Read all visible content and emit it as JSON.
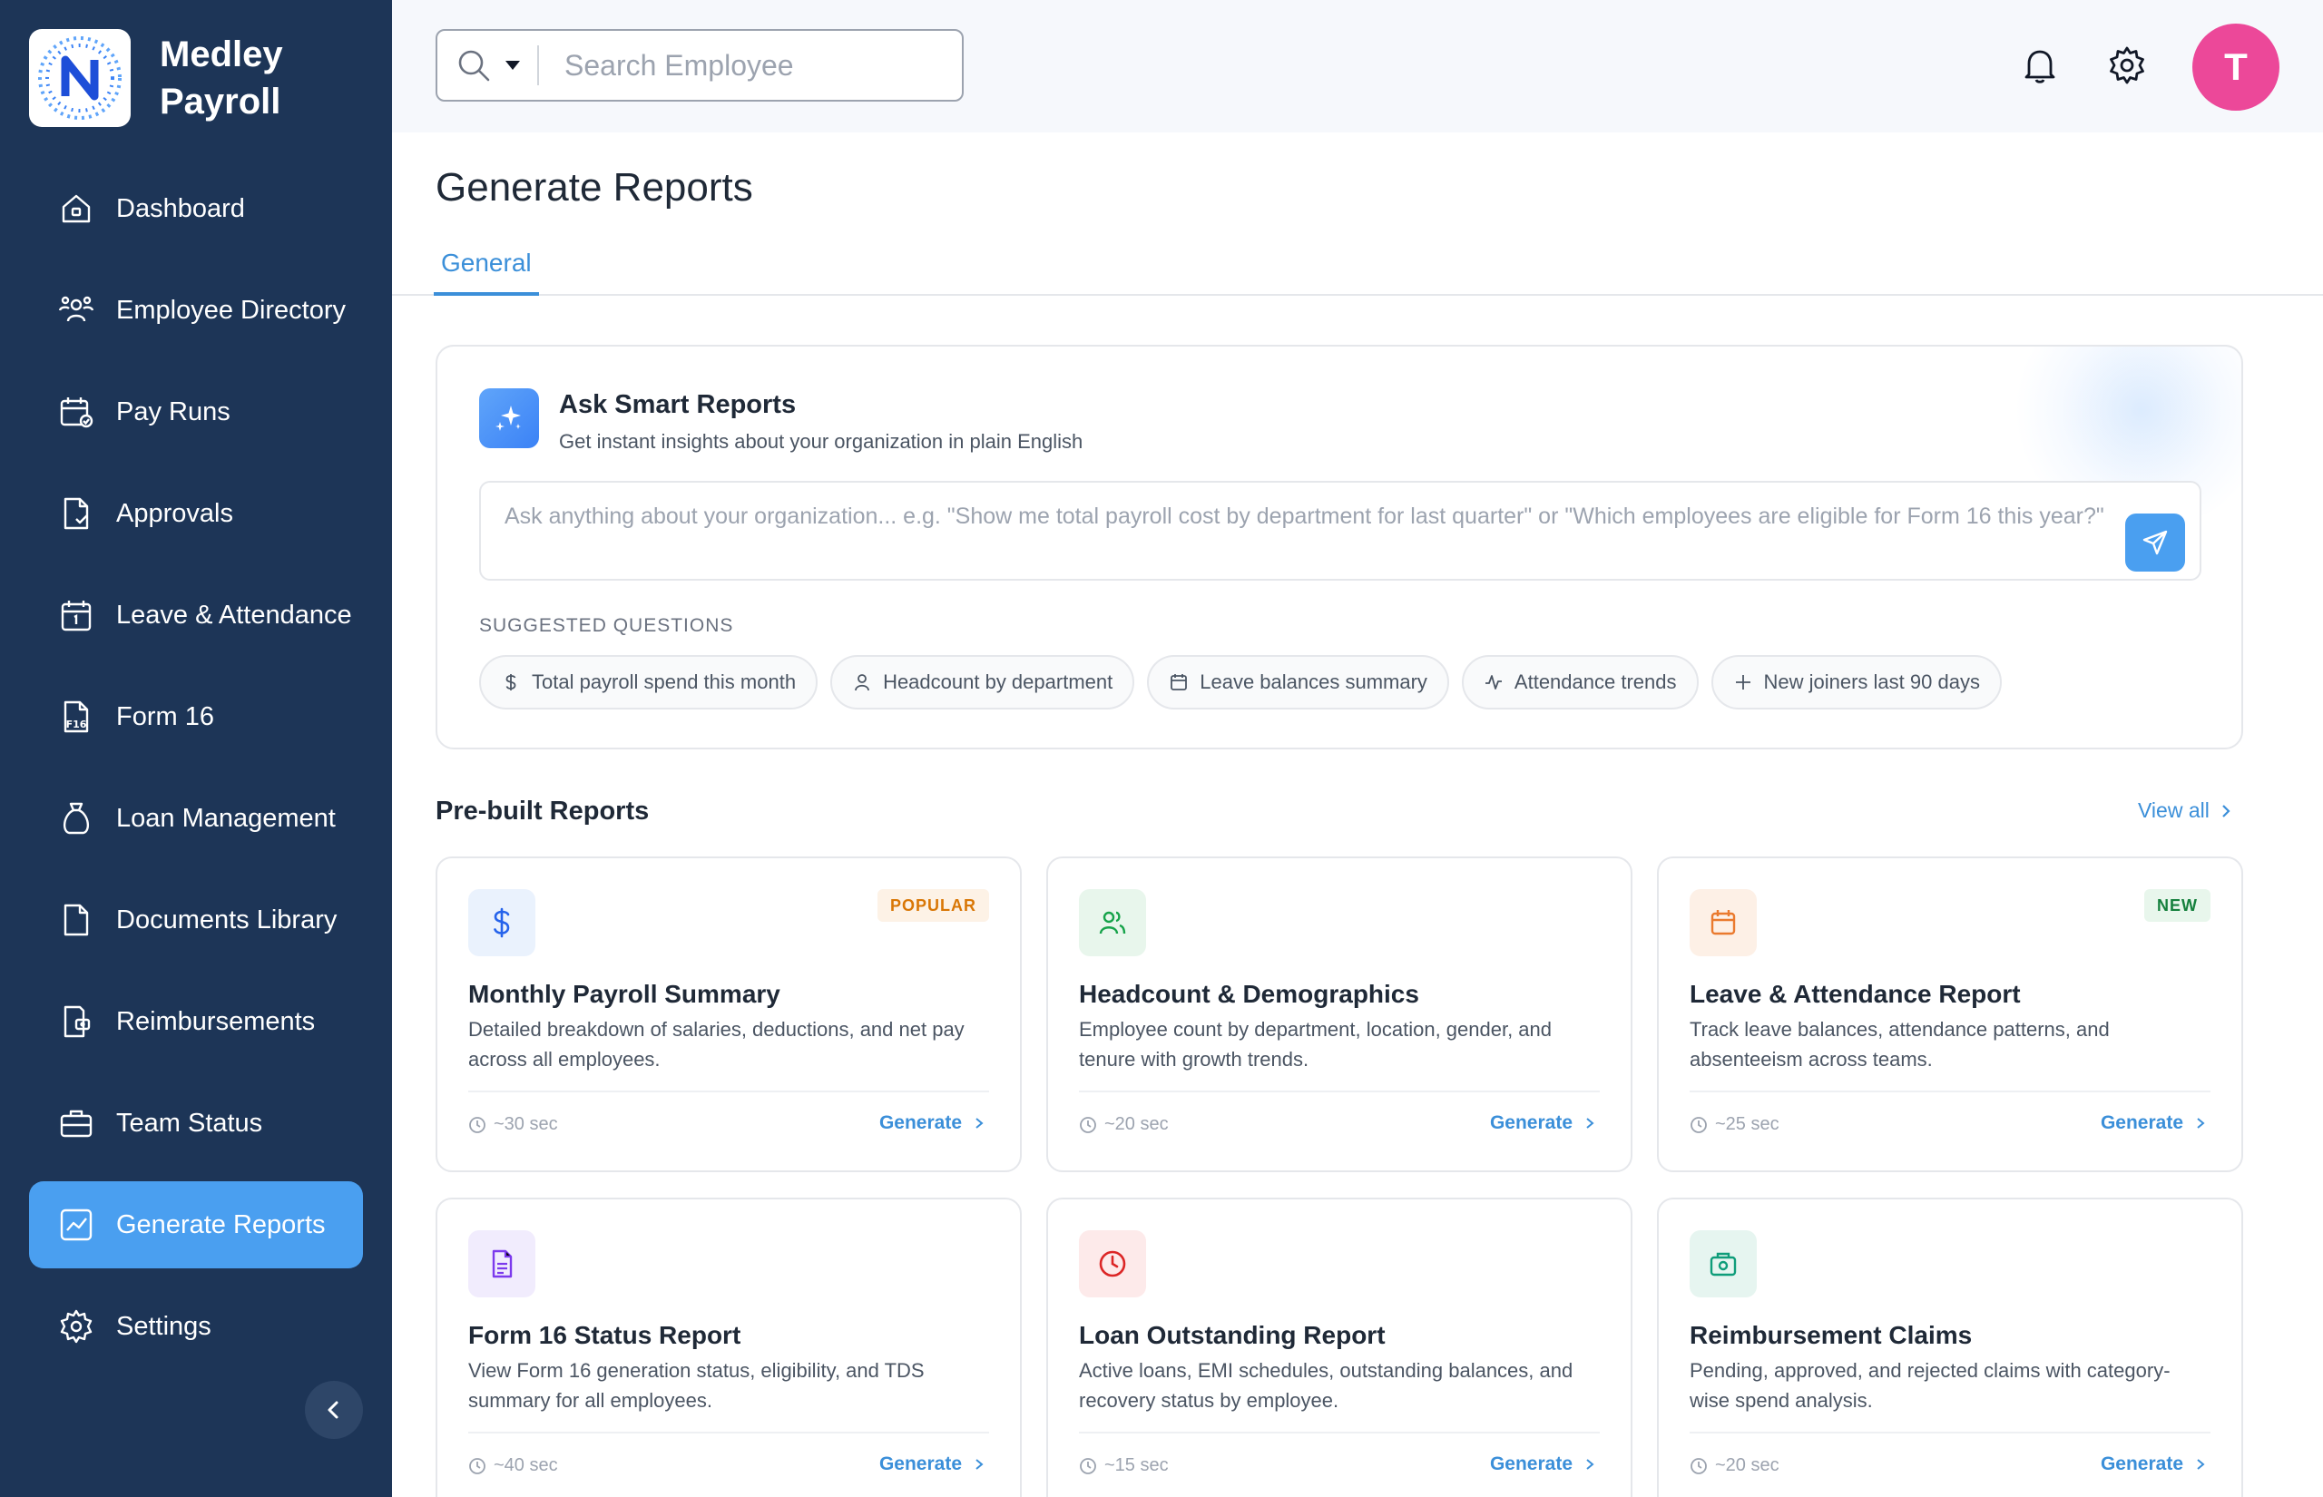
{
  "brand": {
    "name_line1": "Medley",
    "name_line2": "Payroll",
    "logo_letter": "N"
  },
  "sidebar": {
    "items": [
      {
        "label": "Dashboard",
        "icon": "home-icon"
      },
      {
        "label": "Employee Directory",
        "icon": "users-icon"
      },
      {
        "label": "Pay Runs",
        "icon": "calendar-check-icon"
      },
      {
        "label": "Approvals",
        "icon": "document-check-icon"
      },
      {
        "label": "Leave & Attendance",
        "icon": "calendar-icon"
      },
      {
        "label": "Form 16",
        "icon": "form16-icon",
        "icon_text": "F16"
      },
      {
        "label": "Loan Management",
        "icon": "money-bag-icon"
      },
      {
        "label": "Documents Library",
        "icon": "file-icon"
      },
      {
        "label": "Reimbursements",
        "icon": "wallet-icon"
      },
      {
        "label": "Team Status",
        "icon": "briefcase-icon"
      },
      {
        "label": "Generate Reports",
        "icon": "chart-icon",
        "active": true
      },
      {
        "label": "Settings",
        "icon": "gear-icon"
      }
    ]
  },
  "topbar": {
    "search_placeholder": "Search Employee",
    "avatar_initial": "T",
    "avatar_color": "#ec4899"
  },
  "page": {
    "title": "Generate Reports",
    "tab": "General"
  },
  "smart": {
    "title": "Ask Smart Reports",
    "subtitle": "Get instant insights about your organization in plain English",
    "placeholder": "Ask anything about your organization... e.g. \"Show me total payroll cost by department for last quarter\" or \"Which employees are eligible for Form 16 this year?\"",
    "suggested_label": "SUGGESTED QUESTIONS",
    "chips": [
      {
        "label": "Total payroll spend this month",
        "icon": "dollar-icon"
      },
      {
        "label": "Headcount by department",
        "icon": "user-icon"
      },
      {
        "label": "Leave balances summary",
        "icon": "calendar-icon"
      },
      {
        "label": "Attendance trends",
        "icon": "activity-icon"
      },
      {
        "label": "New joiners last 90 days",
        "icon": "plus-icon"
      }
    ]
  },
  "prebuilt": {
    "title": "Pre-built Reports",
    "view_all": "View all",
    "generate_label": "Generate",
    "cards": [
      {
        "title": "Monthly Payroll Summary",
        "desc": "Detailed breakdown of salaries, deductions, and net pay across all employees.",
        "time": "~30 sec",
        "badge": "POPULAR",
        "icon": "dollar-icon",
        "accent": "#2563eb"
      },
      {
        "title": "Headcount & Demographics",
        "desc": "Employee count by department, location, gender, and tenure with growth trends.",
        "time": "~20 sec",
        "badge": "",
        "icon": "users-icon",
        "accent": "#16a34a"
      },
      {
        "title": "Leave & Attendance Report",
        "desc": "Track leave balances, attendance patterns, and absenteeism across teams.",
        "time": "~25 sec",
        "badge": "NEW",
        "icon": "calendar-icon",
        "accent": "#ea7a2e"
      },
      {
        "title": "Form 16 Status Report",
        "desc": "View Form 16 generation status, eligibility, and TDS summary for all employees.",
        "time": "~40 sec",
        "badge": "",
        "icon": "document-icon",
        "accent": "#7c3aed"
      },
      {
        "title": "Loan Outstanding Report",
        "desc": "Active loans, EMI schedules, outstanding balances, and recovery status by employee.",
        "time": "~15 sec",
        "badge": "",
        "icon": "clock-icon",
        "accent": "#dc2626"
      },
      {
        "title": "Reimbursement Claims",
        "desc": "Pending, approved, and rejected claims with category-wise spend analysis.",
        "time": "~20 sec",
        "badge": "",
        "icon": "wallet-icon",
        "accent": "#0f9d7a"
      }
    ]
  }
}
